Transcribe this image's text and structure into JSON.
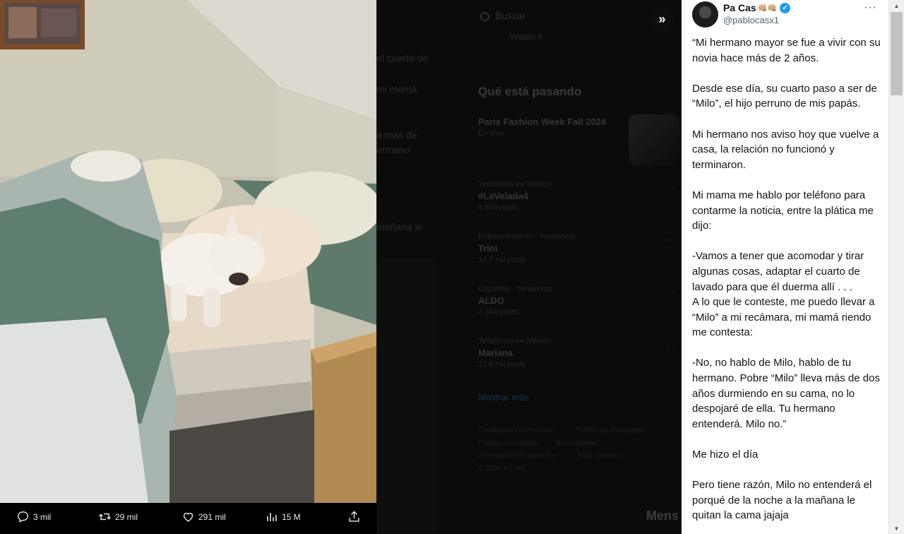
{
  "background": {
    "search_placeholder": "Buscar",
    "title": "Qué está pasando",
    "fragments": [
      "Velada 4",
      "el cuarto de",
      "mi mamá",
      "a más de",
      "ermano",
      "mañana le"
    ],
    "trends": [
      {
        "category": "Paris Fashion Week Fall 2024",
        "name": "",
        "count": "En vivo"
      },
      {
        "category": "Tendencia en México",
        "name": "#LaVelada4",
        "count": "8.859 posts"
      },
      {
        "category": "Entretenimiento · Tendencia",
        "name": "Trini",
        "count": "14,7 mil posts"
      },
      {
        "category": "Deportes · Tendencia",
        "name": "ALDO",
        "count": "2.184 posts"
      },
      {
        "category": "Tendencia en México",
        "name": "Mariana",
        "count": "12,8 mil posts"
      }
    ],
    "show_more": "Mostrar más",
    "footer": [
      "Condiciones de Servicio",
      "Política de Privacidad",
      "Política de cookies",
      "Accesibilidad",
      "Información de anuncios",
      "Más opciones",
      "© 2024 X Corp."
    ],
    "messages_label": "Mens"
  },
  "actions": {
    "replies": "3 mil",
    "reposts": "29 mil",
    "likes": "291 mil",
    "views": "15 M"
  },
  "tweet": {
    "display_name": "Pa Cas",
    "handle": "@pablocasx1",
    "paragraphs": [
      "“Mi hermano mayor se fue a vivir con su novia hace más de 2 años.",
      "Desde ese día, su cuarto paso a ser de “Milo”, el hijo perruno de mis papás.",
      "Mi hermano nos aviso hoy que vuelve a casa, la relación no funcionó y terminaron.",
      "Mi mama me hablo por teléfono para contarme la noticia, entre la plática me dijo:",
      "-Vamos a tener que acomodar y tirar algunas cosas, adaptar el cuarto de lavado para que él duerma allí . . .\nA lo que le conteste, me puedo llevar a “Milo” a mi recámara, mi mamá riendo me contesta:",
      "-No, no hablo de Milo, hablo de tu hermano. Pobre “Milo” lleva más de dos años durmiendo en su cama, no lo despojaré de ella. Tu hermano entenderá. Milo no.”",
      "Me hizo el día",
      "Pero tiene razón, Milo no entenderá el porqué de la noche a la mañana le quitan la cama jajaja"
    ]
  },
  "colors": {
    "verified": "#1d9bf0",
    "text_primary": "#0f1419",
    "text_secondary": "#536471"
  },
  "icons": [
    "chevrons-right-icon",
    "reply-icon",
    "repost-icon",
    "like-icon",
    "views-icon",
    "share-icon",
    "more-icon",
    "verified-icon"
  ]
}
